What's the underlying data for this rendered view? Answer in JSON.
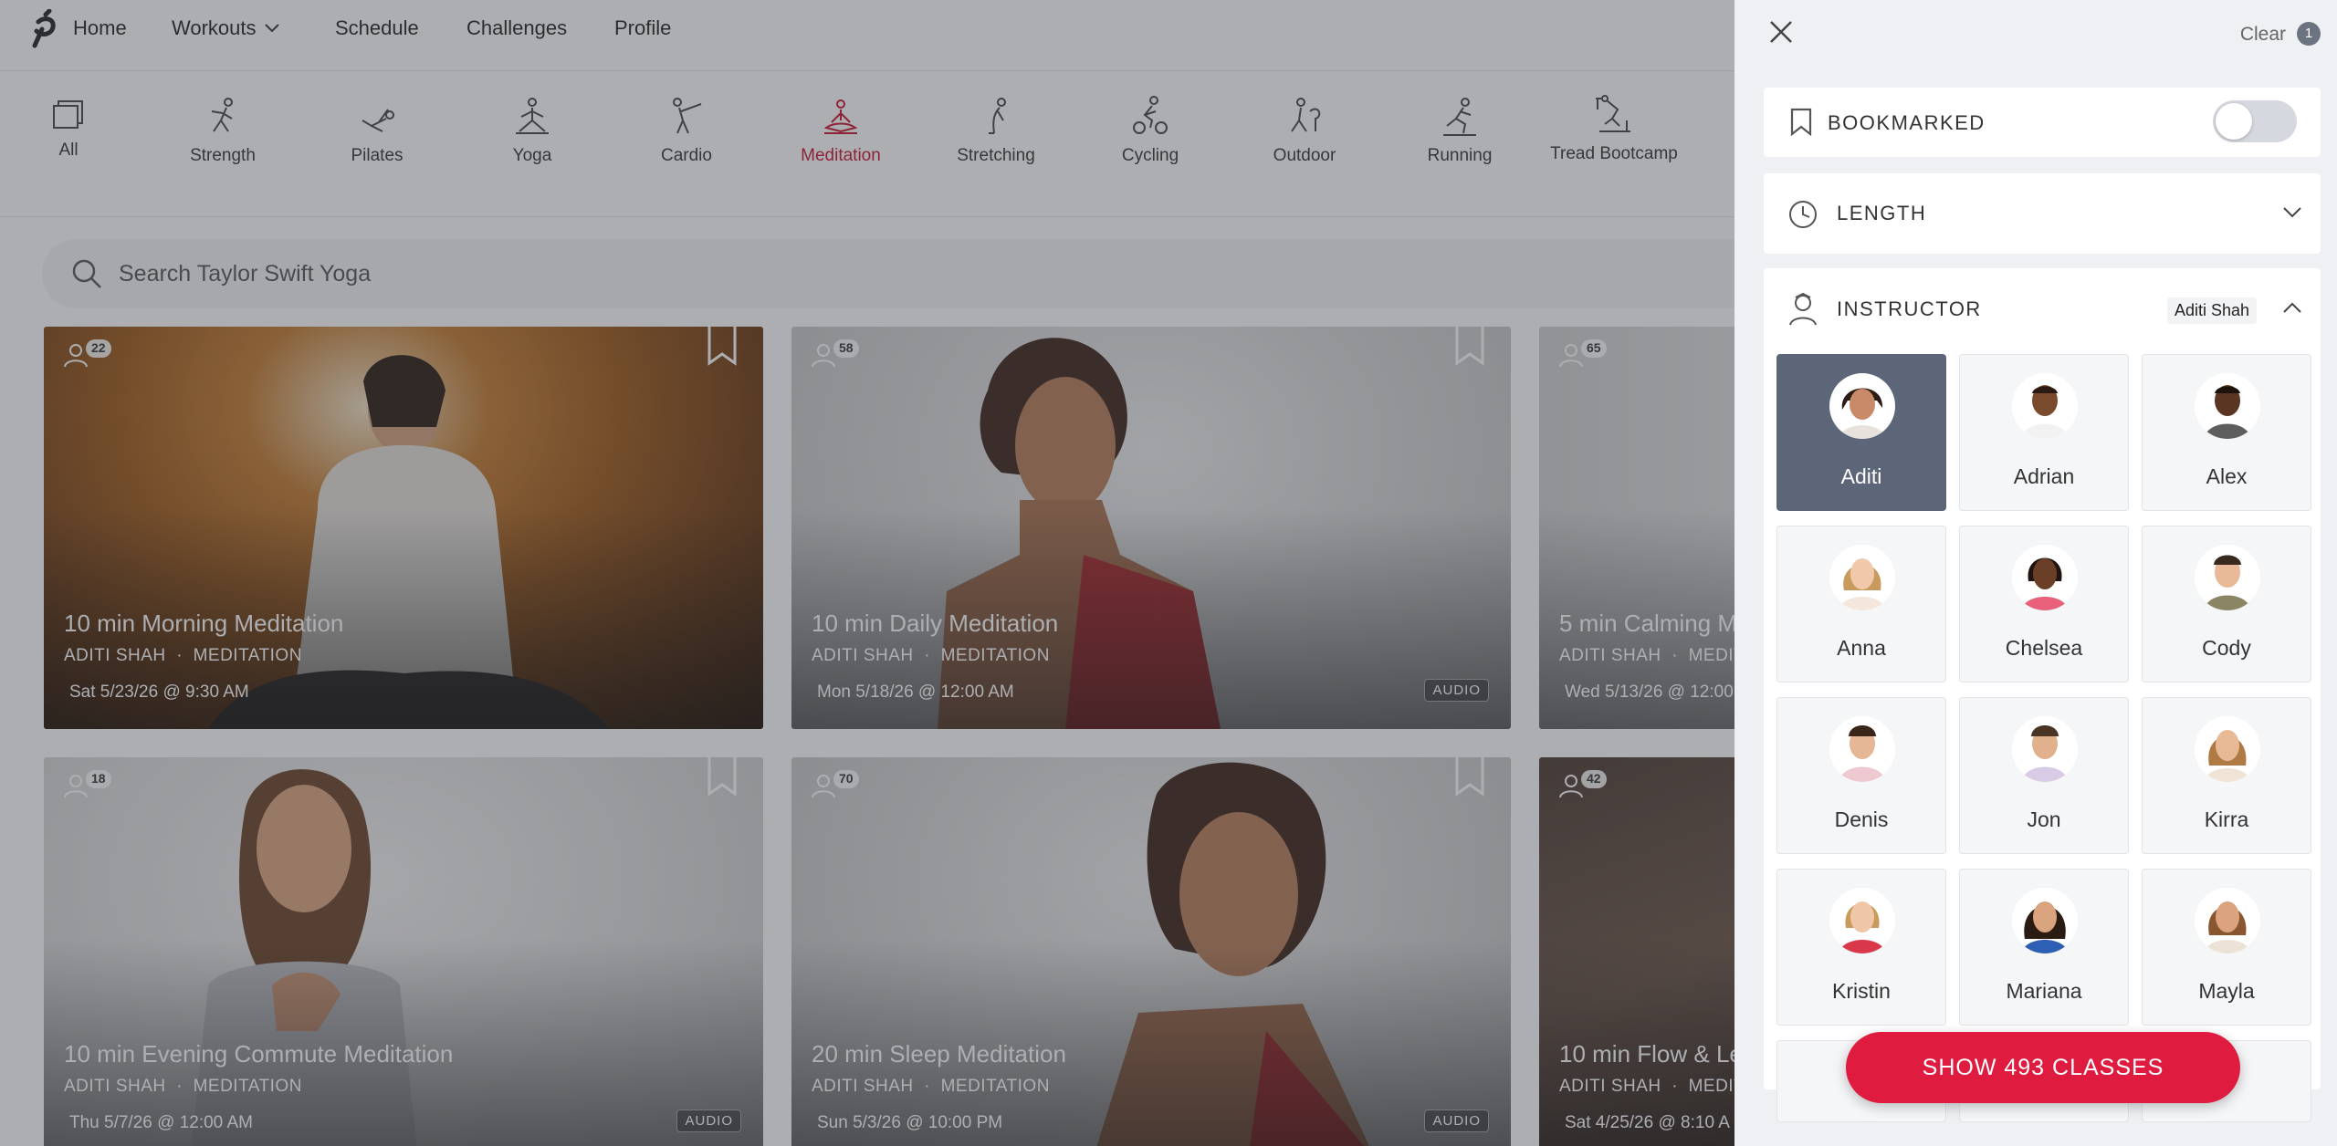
{
  "nav": {
    "home": "Home",
    "workouts": "Workouts",
    "schedule": "Schedule",
    "challenges": "Challenges",
    "profile": "Profile"
  },
  "categories": [
    {
      "label": "All",
      "icon": "stack-icon"
    },
    {
      "label": "Strength",
      "icon": "strength-icon"
    },
    {
      "label": "Pilates",
      "icon": "pilates-icon"
    },
    {
      "label": "Yoga",
      "icon": "yoga-icon"
    },
    {
      "label": "Cardio",
      "icon": "cardio-icon"
    },
    {
      "label": "Meditation",
      "icon": "meditation-icon",
      "active": true
    },
    {
      "label": "Stretching",
      "icon": "stretching-icon"
    },
    {
      "label": "Cycling",
      "icon": "cycling-icon"
    },
    {
      "label": "Outdoor",
      "icon": "outdoor-icon"
    },
    {
      "label": "Running",
      "icon": "running-icon"
    },
    {
      "label": "Tread Bootcamp",
      "icon": "tread-bootcamp-icon"
    }
  ],
  "search": {
    "placeholder": "Search Taylor Swift Yoga"
  },
  "classes": [
    {
      "count": "22",
      "title": "10 min Morning Meditation",
      "instructor": "ADITI SHAH",
      "category": "MEDITATION",
      "date": "Sat 5/23/26 @ 9:30 AM",
      "audio": ""
    },
    {
      "count": "58",
      "title": "10 min Daily Meditation",
      "instructor": "ADITI SHAH",
      "category": "MEDITATION",
      "date": "Mon 5/18/26 @ 12:00 AM",
      "audio": "AUDIO"
    },
    {
      "count": "65",
      "title": "5 min Calming M",
      "instructor": "ADITI SHAH",
      "category": "MEDIT",
      "date": "Wed 5/13/26 @ 12:00",
      "audio": ""
    },
    {
      "count": "18",
      "title": "10 min Evening Commute Meditation",
      "instructor": "ADITI SHAH",
      "category": "MEDITATION",
      "date": "Thu 5/7/26 @ 12:00 AM",
      "audio": "AUDIO"
    },
    {
      "count": "70",
      "title": "20 min Sleep Meditation",
      "instructor": "ADITI SHAH",
      "category": "MEDITATION",
      "date": "Sun 5/3/26 @ 10:00 PM",
      "audio": "AUDIO"
    },
    {
      "count": "42",
      "title": "10 min Flow & Le",
      "instructor": "ADITI SHAH",
      "category": "MEDIT",
      "date": "Sat 4/25/26 @ 8:10 A",
      "audio": ""
    }
  ],
  "meta_separator": "·",
  "panel": {
    "clear_label": "Clear",
    "clear_count": "1",
    "bookmarked_label": "BOOKMARKED",
    "bookmarked_on": false,
    "length_label": "LENGTH",
    "instructor_label": "INSTRUCTOR",
    "instructor_selected": "Aditi Shah",
    "instructors": [
      {
        "name": "Aditi",
        "selected": true,
        "skin": "#c98a6a",
        "hair": "#2b1d16",
        "shirt": "#e7e2dc"
      },
      {
        "name": "Adrian",
        "selected": false,
        "skin": "#7a4a2c",
        "hair": "#2a1a12",
        "shirt": "#f2f2f2"
      },
      {
        "name": "Alex",
        "selected": false,
        "skin": "#5a3622",
        "hair": "#1b120c",
        "shirt": "#5e5e5e"
      },
      {
        "name": "Anna",
        "selected": false,
        "skin": "#f0c9ab",
        "hair": "#c99a5e",
        "shirt": "#f4e6da"
      },
      {
        "name": "Chelsea",
        "selected": false,
        "skin": "#6b3f27",
        "hair": "#1f140e",
        "shirt": "#e8607a"
      },
      {
        "name": "Cody",
        "selected": false,
        "skin": "#e8b996",
        "hair": "#3a2a1e",
        "shirt": "#8b8462"
      },
      {
        "name": "Denis",
        "selected": false,
        "skin": "#e6b797",
        "hair": "#3a2618",
        "shirt": "#efc9d2"
      },
      {
        "name": "Jon",
        "selected": false,
        "skin": "#e1b08c",
        "hair": "#4a3423",
        "shirt": "#d8cbe6"
      },
      {
        "name": "Kirra",
        "selected": false,
        "skin": "#e8b995",
        "hair": "#b07a45",
        "shirt": "#f0e4d6"
      },
      {
        "name": "Kristin",
        "selected": false,
        "skin": "#f0c7a6",
        "hair": "#c89a5c",
        "shirt": "#d9384b"
      },
      {
        "name": "Mariana",
        "selected": false,
        "skin": "#d9a37e",
        "hair": "#2a1b13",
        "shirt": "#2d5fb5"
      },
      {
        "name": "Mayla",
        "selected": false,
        "skin": "#dba47f",
        "hair": "#8a5630",
        "shirt": "#ece3d6"
      }
    ],
    "show_button": "SHOW 493 CLASSES"
  },
  "colors": {
    "brand_red": "#df1b3f",
    "active_category": "#c8102e",
    "selected_tile": "#5d6678"
  }
}
